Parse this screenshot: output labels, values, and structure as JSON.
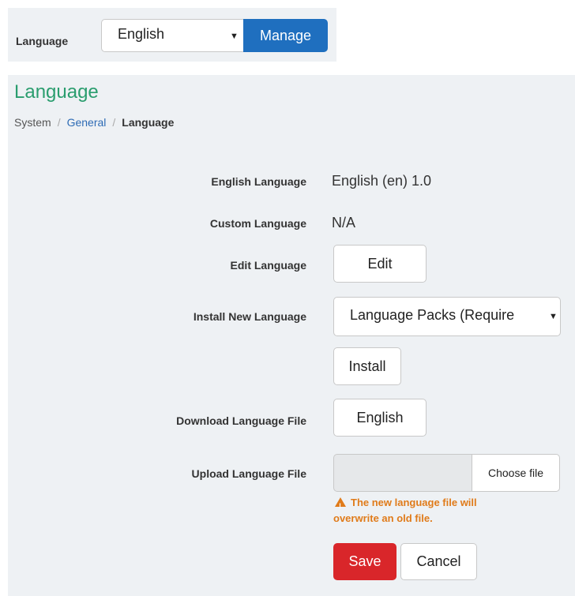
{
  "topbar": {
    "label": "Language",
    "select_value": "English",
    "manage_label": "Manage"
  },
  "page": {
    "title": "Language",
    "breadcrumb": {
      "system": "System",
      "separator": "/",
      "general": "General",
      "current": "Language"
    }
  },
  "form": {
    "english_language": {
      "label": "English Language",
      "value": "English (en) 1.0"
    },
    "custom_language": {
      "label": "Custom Language",
      "value": "N/A"
    },
    "edit_language": {
      "label": "Edit Language",
      "button": "Edit"
    },
    "install_new_language": {
      "label": "Install New Language",
      "select_value": "Language Packs (Require",
      "button": "Install"
    },
    "download_language_file": {
      "label": "Download Language File",
      "button": "English"
    },
    "upload_language_file": {
      "label": "Upload Language File",
      "choose_button": "Choose file",
      "warning_line1": "The new language file will",
      "warning_line2": "overwrite an old file."
    },
    "save_label": "Save",
    "cancel_label": "Cancel"
  },
  "colors": {
    "title": "#2a9d6e",
    "link": "#2d6bb5",
    "primary": "#1f6fbf",
    "danger": "#d9262a",
    "warning": "#e07b1a",
    "panel_bg": "#eef1f4"
  },
  "icons": {
    "caret": "caret-down-icon",
    "warning": "warning-icon"
  }
}
